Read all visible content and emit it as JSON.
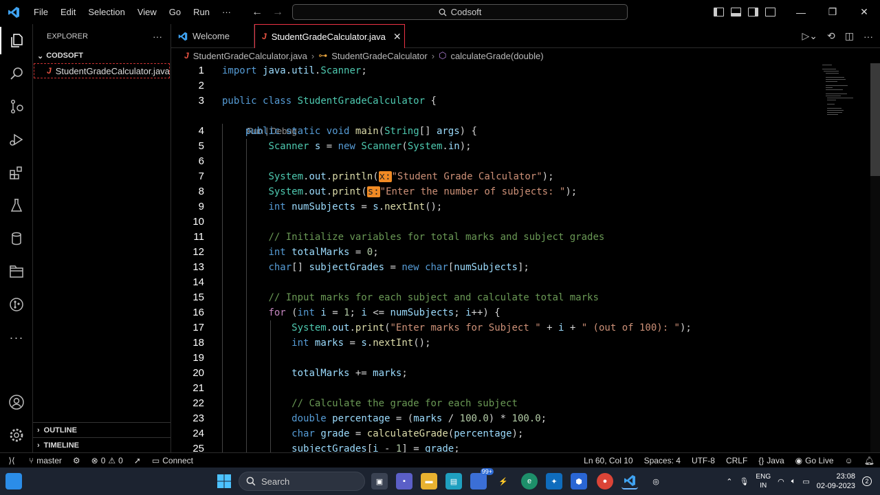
{
  "titlebar": {
    "menu": [
      "File",
      "Edit",
      "Selection",
      "View",
      "Go",
      "Run",
      "···"
    ],
    "search_text": "Codsoft"
  },
  "sidebar": {
    "header": "EXPLORER",
    "more": "···",
    "folder": "CODSOFT",
    "files": [
      "StudentGradeCalculator.java"
    ],
    "outline": "OUTLINE",
    "timeline": "TIMELINE"
  },
  "tabs": [
    {
      "label": "Welcome",
      "active": false
    },
    {
      "label": "StudentGradeCalculator.java",
      "active": true
    }
  ],
  "breadcrumb": [
    "StudentGradeCalculator.java",
    "StudentGradeCalculator",
    "calculateGrade(double)"
  ],
  "code": {
    "codelens": "Run | Debug",
    "lines": [
      {
        "n": "1",
        "text": "import java.util.Scanner;"
      },
      {
        "n": "2",
        "text": ""
      },
      {
        "n": "3",
        "text": "public class StudentGradeCalculator {"
      },
      {
        "n": "4",
        "text": "    public static void main(String[] args) {"
      },
      {
        "n": "5",
        "text": "        Scanner s = new Scanner(System.in);"
      },
      {
        "n": "6",
        "text": ""
      },
      {
        "n": "7",
        "text": "        System.out.println(x:\"Student Grade Calculator\");"
      },
      {
        "n": "8",
        "text": "        System.out.print(s:\"Enter the number of subjects: \");"
      },
      {
        "n": "9",
        "text": "        int numSubjects = s.nextInt();"
      },
      {
        "n": "10",
        "text": ""
      },
      {
        "n": "11",
        "text": "        // Initialize variables for total marks and subject grades"
      },
      {
        "n": "12",
        "text": "        int totalMarks = 0;"
      },
      {
        "n": "13",
        "text": "        char[] subjectGrades = new char[numSubjects];"
      },
      {
        "n": "14",
        "text": ""
      },
      {
        "n": "15",
        "text": "        // Input marks for each subject and calculate total marks"
      },
      {
        "n": "16",
        "text": "        for (int i = 1; i <= numSubjects; i++) {"
      },
      {
        "n": "17",
        "text": "            System.out.print(\"Enter marks for Subject \" + i + \" (out of 100): \");"
      },
      {
        "n": "18",
        "text": "            int marks = s.nextInt();"
      },
      {
        "n": "19",
        "text": ""
      },
      {
        "n": "20",
        "text": "            totalMarks += marks;"
      },
      {
        "n": "21",
        "text": ""
      },
      {
        "n": "22",
        "text": "            // Calculate the grade for each subject"
      },
      {
        "n": "23",
        "text": "            double percentage = (marks / 100.0) * 100.0;"
      },
      {
        "n": "24",
        "text": "            char grade = calculateGrade(percentage);"
      },
      {
        "n": "25",
        "text": "            subjectGrades[i - 1] = grade;"
      }
    ]
  },
  "statusbar": {
    "branch": "master",
    "errors": "0",
    "warnings": "0",
    "connect": "Connect",
    "position": "Ln 60, Col 10",
    "spaces": "Spaces: 4",
    "encoding": "UTF-8",
    "eol": "CRLF",
    "language": "Java",
    "golive": "Go Live"
  },
  "taskbar": {
    "search": "Search",
    "badge": "99+",
    "lang_top": "ENG",
    "lang_bottom": "IN",
    "time": "23:08",
    "date": "02-09-2023"
  },
  "colors": {
    "accent_tab_border": "#e34",
    "keyword": "#569cd6",
    "type": "#4ec9b0",
    "string": "#ce9178",
    "comment": "#6a9955",
    "hint": "#f08a24"
  }
}
